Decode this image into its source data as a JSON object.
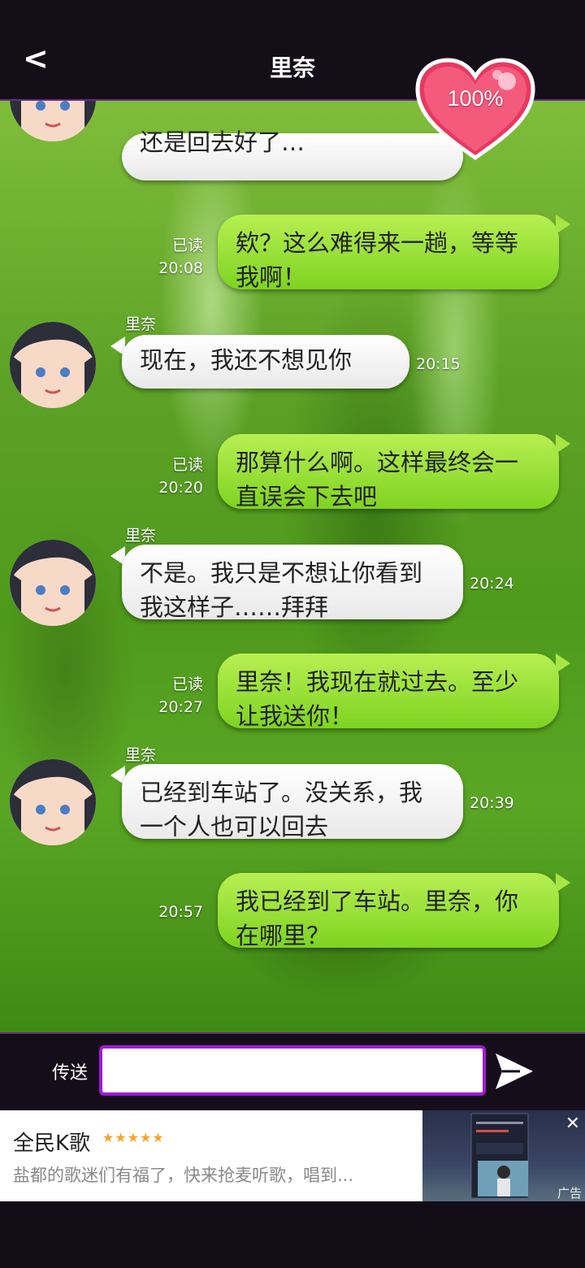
{
  "header": {
    "back_label": "<",
    "title": "里奈",
    "affection": "100%"
  },
  "messages": [
    {
      "side": "left",
      "sender": "",
      "text": "还是回去好了…",
      "time": ""
    },
    {
      "side": "right",
      "status": "已读",
      "time": "20:08",
      "text": "欸？这么难得来一趟，等等我啊！"
    },
    {
      "side": "left",
      "sender": "里奈",
      "text": "现在，我还不想见你",
      "time": "20:15"
    },
    {
      "side": "right",
      "status": "已读",
      "time": "20:20",
      "text": "那算什么啊。这样最终会一直误会下去吧"
    },
    {
      "side": "left",
      "sender": "里奈",
      "text": "不是。我只是不想让你看到我这样子……拜拜",
      "time": "20:24"
    },
    {
      "side": "right",
      "status": "已读",
      "time": "20:27",
      "text": "里奈！我现在就过去。至少让我送你！"
    },
    {
      "side": "left",
      "sender": "里奈",
      "text": "已经到车站了。没关系，我一个人也可以回去",
      "time": "20:39"
    },
    {
      "side": "right",
      "status": "",
      "time": "20:57",
      "text": "我已经到了车站。里奈，你在哪里？"
    }
  ],
  "input": {
    "label": "传送",
    "value": ""
  },
  "ad": {
    "title": "全民K歌",
    "stars": "★★★★★",
    "description": "盐都的歌迷们有福了，快来抢麦听歌，唱到...",
    "tag": "广告",
    "close": "✕"
  },
  "colors": {
    "accent": "#a01ad8",
    "bubble_right": "#8fdc2e",
    "bubble_left": "#ffffff",
    "heart": "#f0406a"
  }
}
